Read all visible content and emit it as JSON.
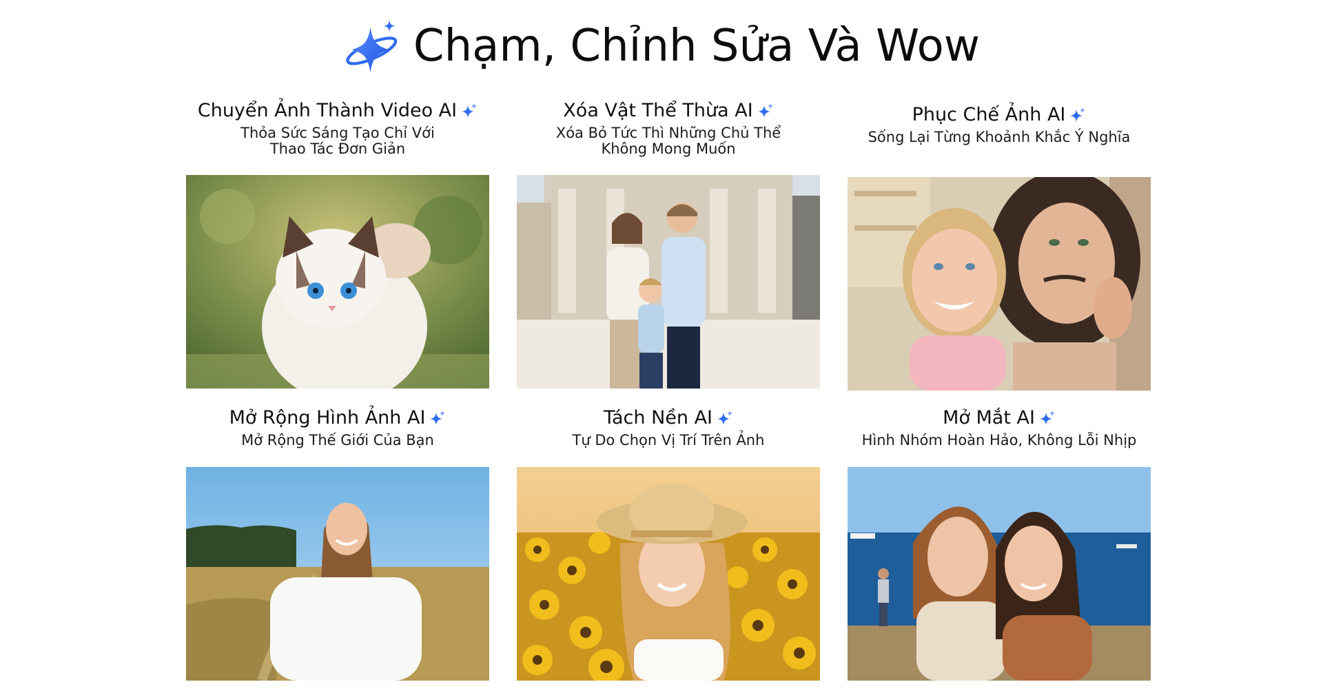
{
  "page": {
    "title": "Chạm, Chỉnh Sửa Và Wow",
    "icon": "sparkle-orbit-icon",
    "accent": "#2f6cf0"
  },
  "features": [
    {
      "title": "Chuyển Ảnh Thành Video AI",
      "subtitle": "Thỏa Sức Sáng Tạo Chỉ Với\nThao Tác Đơn Giản",
      "image": "ragdoll-cat-photo",
      "icon": "sparkle-icon"
    },
    {
      "title": "Xóa Vật Thể Thừa AI",
      "subtitle": "Xóa Bỏ Tức Thì Những Chủ Thể\nKhông Mong Muốn",
      "image": "family-in-plaza-photo",
      "icon": "sparkle-icon"
    },
    {
      "title": "Phục Chế Ảnh AI",
      "subtitle": "Sống Lại Từng Khoảnh Khắc Ý Nghĩa",
      "image": "mother-daughter-selfie-photo",
      "icon": "sparkle-icon"
    },
    {
      "title": "Mở Rộng Hình Ảnh AI",
      "subtitle": "Mở Rộng Thế Giới Của Bạn",
      "image": "girl-in-field-photo",
      "icon": "sparkle-icon"
    },
    {
      "title": "Tách Nền AI",
      "subtitle": "Tự Do Chọn Vị Trí Trên Ảnh",
      "image": "girl-sunflowers-photo",
      "icon": "sparkle-icon"
    },
    {
      "title": "Mở Mắt AI",
      "subtitle": "Hình Nhóm Hoàn Hảo, Không Lỗi Nhịp",
      "image": "two-women-seaside-photo",
      "icon": "sparkle-icon"
    }
  ]
}
